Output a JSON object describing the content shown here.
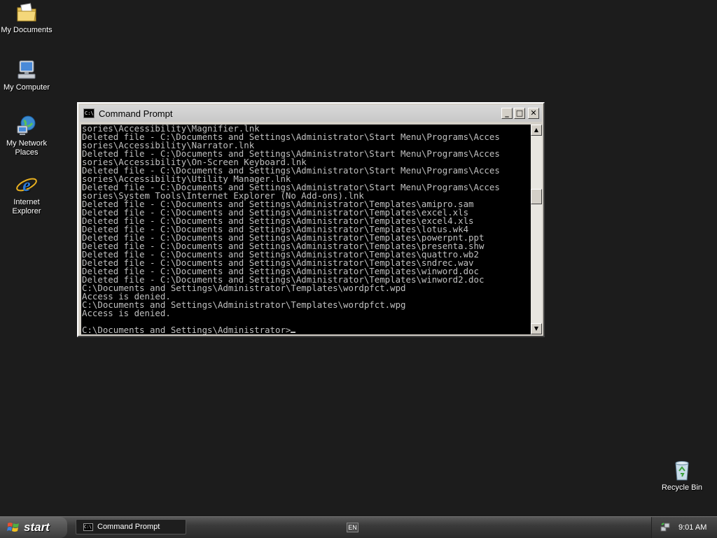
{
  "desktop": {
    "icons": [
      {
        "label_line1": "My Documents",
        "label_line2": "",
        "icon": "my-documents-icon"
      },
      {
        "label_line1": "My Computer",
        "label_line2": "",
        "icon": "my-computer-icon"
      },
      {
        "label_line1": "My Network",
        "label_line2": "Places",
        "icon": "network-places-icon"
      },
      {
        "label_line1": "Internet",
        "label_line2": "Explorer",
        "icon": "internet-explorer-icon"
      },
      {
        "label_line1": "Recycle Bin",
        "label_line2": "",
        "icon": "recycle-bin-icon"
      }
    ]
  },
  "window": {
    "title": "Command Prompt",
    "icon_text": "C:\\",
    "controls": {
      "minimize": "_",
      "maximize": "□",
      "close": "✕"
    }
  },
  "console": {
    "lines": [
      "sories\\Accessibility\\Magnifier.lnk",
      "Deleted file - C:\\Documents and Settings\\Administrator\\Start Menu\\Programs\\Acces",
      "sories\\Accessibility\\Narrator.lnk",
      "Deleted file - C:\\Documents and Settings\\Administrator\\Start Menu\\Programs\\Acces",
      "sories\\Accessibility\\On-Screen Keyboard.lnk",
      "Deleted file - C:\\Documents and Settings\\Administrator\\Start Menu\\Programs\\Acces",
      "sories\\Accessibility\\Utility Manager.lnk",
      "Deleted file - C:\\Documents and Settings\\Administrator\\Start Menu\\Programs\\Acces",
      "sories\\System Tools\\Internet Explorer (No Add-ons).lnk",
      "Deleted file - C:\\Documents and Settings\\Administrator\\Templates\\amipro.sam",
      "Deleted file - C:\\Documents and Settings\\Administrator\\Templates\\excel.xls",
      "Deleted file - C:\\Documents and Settings\\Administrator\\Templates\\excel4.xls",
      "Deleted file - C:\\Documents and Settings\\Administrator\\Templates\\lotus.wk4",
      "Deleted file - C:\\Documents and Settings\\Administrator\\Templates\\powerpnt.ppt",
      "Deleted file - C:\\Documents and Settings\\Administrator\\Templates\\presenta.shw",
      "Deleted file - C:\\Documents and Settings\\Administrator\\Templates\\quattro.wb2",
      "Deleted file - C:\\Documents and Settings\\Administrator\\Templates\\sndrec.wav",
      "Deleted file - C:\\Documents and Settings\\Administrator\\Templates\\winword.doc",
      "Deleted file - C:\\Documents and Settings\\Administrator\\Templates\\winword2.doc",
      "C:\\Documents and Settings\\Administrator\\Templates\\wordpfct.wpd",
      "Access is denied.",
      "C:\\Documents and Settings\\Administrator\\Templates\\wordpfct.wpg",
      "Access is denied.",
      "",
      "C:\\Documents and Settings\\Administrator>"
    ]
  },
  "scrollbar": {
    "up_arrow": "▲",
    "down_arrow": "▼"
  },
  "taskbar": {
    "start_label": "start",
    "task_label": "Command Prompt",
    "task_icon_text": "C:\\",
    "language": "EN",
    "clock": "9:01 AM"
  }
}
